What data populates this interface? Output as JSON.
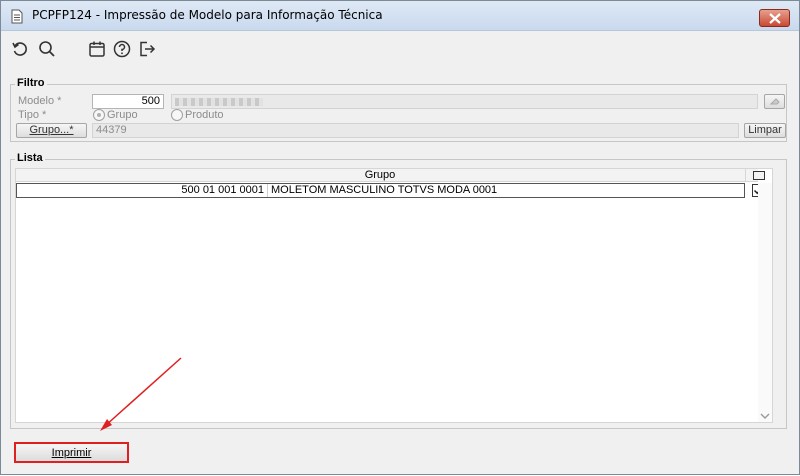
{
  "window": {
    "title": "PCPFP124 - Impressão de Modelo para Informação Técnica",
    "accent_close": "#c84a33"
  },
  "toolbar": {
    "icons": [
      "refresh-icon",
      "search-icon",
      "calendar-icon",
      "help-icon",
      "exit-icon"
    ]
  },
  "filtro": {
    "legend": "Filtro",
    "modelo_label": "Modelo *",
    "modelo_value": "500",
    "modelo_desc": "",
    "tipo_label": "Tipo *",
    "tipo_options": [
      "Grupo",
      "Produto"
    ],
    "tipo_selected": "Grupo",
    "grupo_button": "Grupo...*",
    "grupo_value": "44379",
    "limpar_button": "Limpar"
  },
  "lista": {
    "legend": "Lista",
    "column_header": "Grupo",
    "rows": [
      {
        "code": "500 01 001 0001",
        "description": "MOLETOM MASCULINO TOTVS MODA 0001",
        "checked": true
      }
    ]
  },
  "footer": {
    "print_button": "Imprimir",
    "highlight_color": "#e02020"
  }
}
